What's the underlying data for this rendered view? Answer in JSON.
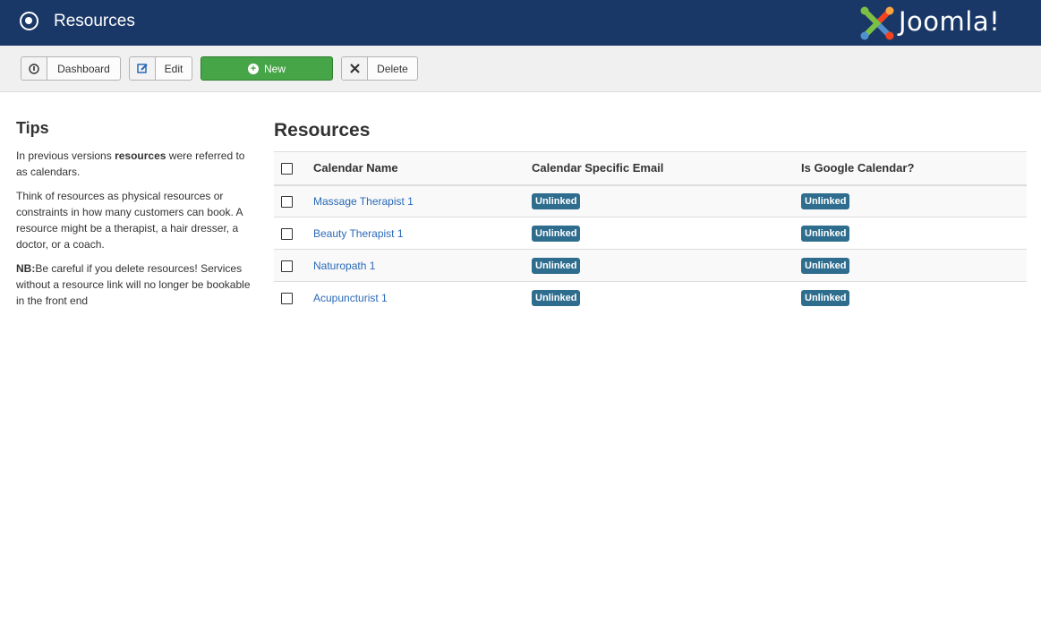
{
  "header": {
    "title": "Resources",
    "logo_text": "Joomla!"
  },
  "toolbar": {
    "dashboard_label": "Dashboard",
    "edit_label": "Edit",
    "new_label": "New",
    "delete_label": "Delete"
  },
  "tips": {
    "title": "Tips",
    "p1_before": "In previous versions ",
    "p1_bold": "resources",
    "p1_after": " were referred to as calendars.",
    "p2": "Think of resources as physical resources or constraints in how many customers can book. A resource might be a therapist, a hair dresser, a doctor, or a coach.",
    "p3_bold": "NB:",
    "p3_after": "Be careful if you delete resources! Services without a resource link will no longer be bookable in the front end"
  },
  "main": {
    "title": "Resources",
    "columns": [
      "Calendar Name",
      "Calendar Specific Email",
      "Is Google Calendar?"
    ],
    "rows": [
      {
        "name": "Massage Therapist 1",
        "email": "Unlinked",
        "google": "Unlinked"
      },
      {
        "name": "Beauty Therapist 1",
        "email": "Unlinked",
        "google": "Unlinked"
      },
      {
        "name": "Naturopath 1",
        "email": "Unlinked",
        "google": "Unlinked"
      },
      {
        "name": "Acupuncturist 1",
        "email": "Unlinked",
        "google": "Unlinked"
      }
    ]
  },
  "colors": {
    "header_bg": "#1a3867",
    "new_button": "#46a546",
    "badge": "#2e6d8e",
    "link": "#2a69b8"
  }
}
